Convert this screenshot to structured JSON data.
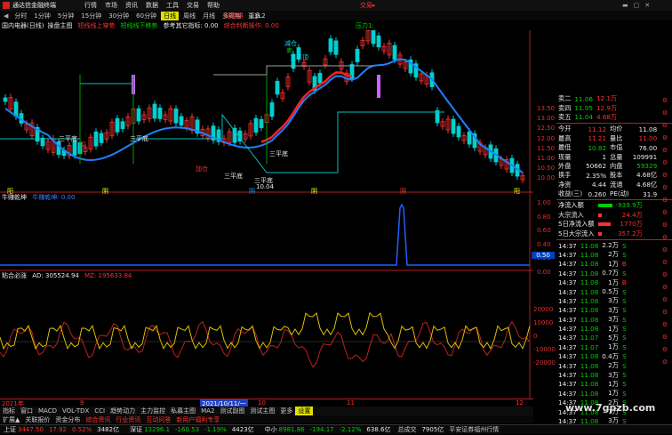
{
  "window": {
    "app_title": "通达信金融终端",
    "menus": [
      "行情",
      "市场",
      "资讯",
      "数据",
      "工具",
      "交易",
      "帮助"
    ],
    "broker": "交易▸",
    "time_frame_tabs": [
      "分时",
      "1分钟",
      "5分钟",
      "15分钟",
      "30分钟",
      "60分钟",
      "日线",
      "周线",
      "月线",
      "多周期",
      "更多"
    ],
    "active_tab": "日线",
    "extra_tabs": [
      "综合屏",
      "L1L2"
    ]
  },
  "main_panel": {
    "stock_title": "国内电器(日线)",
    "indicator": "操盘主图",
    "params": [
      {
        "text": "短线线上穿势",
        "color": "#ff3030"
      },
      {
        "text": "短线线下移势",
        "color": "#00d000"
      },
      {
        "text": "参考其它指标: 0.00",
        "color": "#e8e8e8"
      },
      {
        "text": "综合判断操作: 0.00",
        "color": "#ff3030"
      }
    ],
    "pressure_label": "压力1:",
    "signals": [
      {
        "text": "三平底",
        "color": "#e8e8e8"
      },
      {
        "text": "三平底",
        "color": "#e8e8e8"
      },
      {
        "text": "三平底",
        "color": "#e8e8e8"
      },
      {
        "text": "三平底",
        "color": "#e8e8e8"
      },
      {
        "text": "三平底",
        "color": "#e8e8e8"
      },
      {
        "text": "三平顶",
        "color": "#00e0ff"
      },
      {
        "text": "减仓",
        "color": "#00e0ff"
      },
      {
        "text": "加仓",
        "color": "#ff3030"
      },
      {
        "text": "卖",
        "color": "#00d000"
      },
      {
        "text": "买",
        "color": "#ff3030"
      }
    ],
    "low_mark": "10.04",
    "markers": [
      "阳",
      "阴",
      "阴",
      "阴",
      "阴",
      "阳"
    ]
  },
  "sub_panel1": {
    "indicator": "牛赚乾坤",
    "value_label": "牛赚乾坤: 0.00",
    "axis": [
      "1.00",
      "0.80",
      "0.60",
      "0.40",
      "0.20",
      "0.00"
    ],
    "highlight_value": "0.50"
  },
  "sub_panel2": {
    "indicator": "粘合必涨",
    "ad_label": "AD: 305524.94",
    "mz_label": "MZ: 195633.84",
    "axis": [
      "20000",
      "10000",
      "0",
      "-10000",
      "-20000"
    ]
  },
  "time_axis": {
    "year": "2021年",
    "selected_date": "2021/10/11/一",
    "marks": [
      "9",
      "10",
      "11",
      "12"
    ]
  },
  "bottom_tabs": [
    "指标",
    "窗口",
    "MACD",
    "VOL-TDX",
    "CCI",
    "趋势动力",
    "主力监控",
    "私募主图",
    "MA2",
    "测试副图",
    "测试主图",
    "更多",
    "设置"
  ],
  "bottom_links": [
    "扩展▲",
    "关联报价",
    "资金分布",
    "综合资讯",
    "行业资讯",
    "互动问答",
    "新用户福利专享"
  ],
  "price_axis": [
    "13.50",
    "13.00",
    "12.50",
    "12.00",
    "11.50",
    "11.00",
    "10.50",
    "10.00"
  ],
  "quote": {
    "asks": [
      {
        "label": "卖二",
        "price": "11.06",
        "vol": "12.1万"
      },
      {
        "label": "卖四",
        "price": "11.05",
        "vol": "12.9万"
      },
      {
        "label": "卖五",
        "price": "11.04",
        "vol": "4.68万"
      }
    ],
    "stats": [
      {
        "l1": "今开",
        "v1": "11.12",
        "l2": "均价",
        "v2": "11.08"
      },
      {
        "l1": "最高",
        "v1": "11.21",
        "l2": "量比",
        "v2": "11.00"
      },
      {
        "l1": "最低",
        "v1": "10.82",
        "l2": "市值",
        "v2": "76.00"
      },
      {
        "l1": "现量",
        "v1": "1",
        "l2": "总量",
        "v2": "109991"
      },
      {
        "l1": "外盘",
        "v1": "50662",
        "l2": "内盘",
        "v2": "59329"
      },
      {
        "l1": "换手",
        "v1": "2.35%",
        "l2": "股本",
        "v2": "4.68亿"
      },
      {
        "l1": "净资",
        "v1": "4.44",
        "l2": "流通",
        "v2": "4.68亿"
      },
      {
        "l1": "收益(三)",
        "v1": "0.260",
        "l2": "PE(动)",
        "v2": "31.9"
      }
    ],
    "flows": [
      {
        "label": "净流入额",
        "value": "-939.9万",
        "color": "#00d000"
      },
      {
        "label": "大宗流入",
        "value": "24.4万",
        "color": "#ff3030"
      },
      {
        "label": "5日净流入额",
        "value": "1770万",
        "color": "#ff3030"
      },
      {
        "label": "5日大宗流入",
        "value": "357.2万",
        "color": "#ff3030"
      }
    ],
    "ticks": [
      [
        "14:37",
        "11.08",
        "2.2万",
        "S"
      ],
      [
        "14:37",
        "11.08",
        "2万",
        "S"
      ],
      [
        "14:37",
        "11.08",
        "1万",
        "B"
      ],
      [
        "14:37",
        "11.08",
        "0.7万",
        "S"
      ],
      [
        "14:37",
        "11.08",
        "1万",
        "B"
      ],
      [
        "14:37",
        "11.08",
        "0.5万",
        "S"
      ],
      [
        "14:37",
        "11.08",
        "3万",
        "S"
      ],
      [
        "14:37",
        "11.08",
        "3万",
        "S"
      ],
      [
        "14:37",
        "11.08",
        "3万",
        "S"
      ],
      [
        "14:37",
        "11.08",
        "1万",
        "S"
      ],
      [
        "14:37",
        "11.07",
        "5万",
        "S"
      ],
      [
        "14:37",
        "11.07",
        "1万",
        "S"
      ],
      [
        "14:37",
        "11.08",
        "0.4万",
        "S"
      ],
      [
        "14:37",
        "11.08",
        "2万",
        "S"
      ],
      [
        "14:37",
        "11.08",
        "3万",
        "S"
      ],
      [
        "14:37",
        "11.08",
        "1万",
        "S"
      ],
      [
        "14:37",
        "11.08",
        "1万",
        "S"
      ],
      [
        "14:37",
        "11.08",
        "2万",
        "S"
      ],
      [
        "14:37",
        "11.08",
        "1万",
        "S"
      ],
      [
        "14:37",
        "11.08",
        "3万",
        "S"
      ],
      [
        "14:37",
        "11.08",
        "2万",
        "S"
      ]
    ]
  },
  "status": [
    {
      "name": "上证",
      "value": "3447.50",
      "chg": "17.92",
      "pct": "0.52%",
      "amt": "3482亿",
      "up": true
    },
    {
      "name": "深证",
      "value": "13296.1",
      "chg": "-160.53",
      "pct": "-1.19%",
      "amt": "4423亿",
      "up": false
    },
    {
      "name": "中小",
      "value": "8981.86",
      "chg": "-194.17",
      "pct": "-2.12%",
      "amt": "638.6亿",
      "up": false
    }
  ],
  "status_extra": [
    "总成交",
    "7905亿",
    "平安证券福州行情"
  ],
  "watermark": "www.7gpzb.com"
}
